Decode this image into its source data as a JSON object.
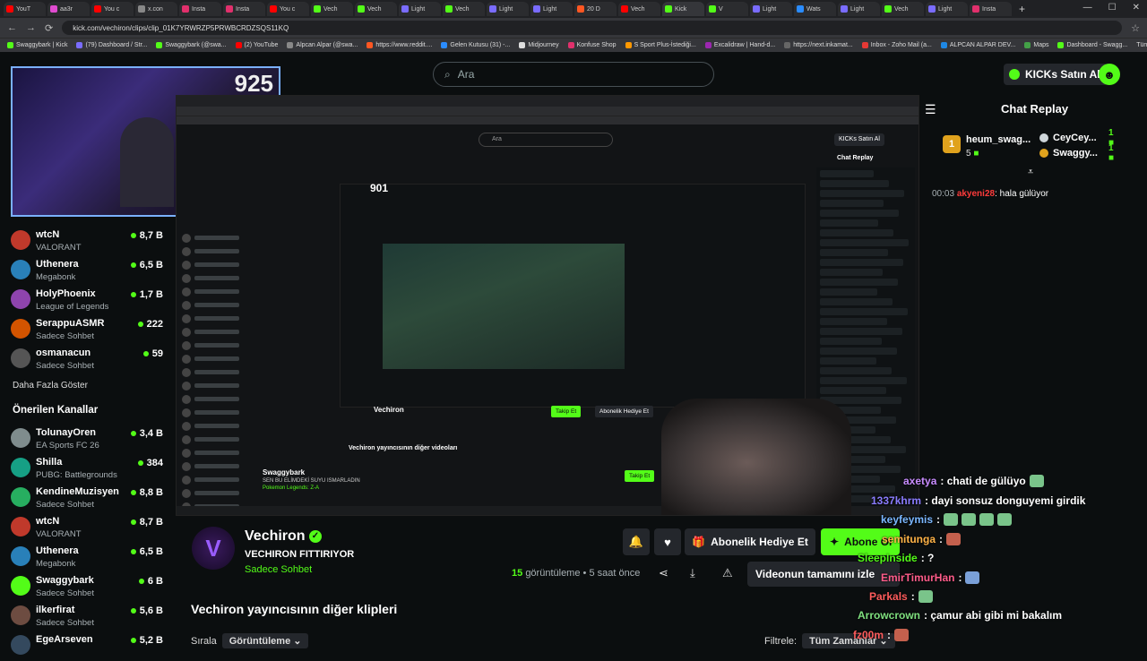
{
  "browser": {
    "tabs": [
      "YouT",
      "aa3r",
      "You c",
      "x.con",
      "Insta",
      "Insta",
      "You c",
      "Vech",
      "Vech",
      "Light",
      "Vech",
      "Light",
      "Light",
      "20 D",
      "Vech",
      "Kick",
      "V",
      "Light",
      "Wats",
      "Light",
      "Vech",
      "Light",
      "Insta"
    ],
    "url": "kick.com/vechiron/clips/clip_01K7YRWRZP5PRWBCRDZSQS11KQ",
    "bookmarks": [
      "Swaggybark | Kick",
      "(79) Dashboard / Str...",
      "Swaggybark (@swa...",
      "(2) YouTube",
      "Alpcan Alpar (@swa...",
      "https://www.reddit....",
      "Gelen Kutusu (31) -...",
      "Midjourney",
      "Konfuse Shop",
      "S Sport Plus-İstediği...",
      "Excalidraw | Hand-d...",
      "https://next.inkamat...",
      "Inbox - Zoho Mail (a...",
      "ALPCAN ALPAR DEV...",
      "Maps",
      "Dashboard - Swagg..."
    ],
    "bookmarks_right": "Tüm Yer İşaretleri"
  },
  "header": {
    "search_placeholder": "Ara",
    "kicks_label": "KICKs Satın Al"
  },
  "webcam": {
    "viewer_count": "925"
  },
  "sidebar": {
    "followed": [
      {
        "name": "wtcN",
        "category": "VALORANT",
        "viewers": "8,7 B",
        "color": "#c0392b"
      },
      {
        "name": "Uthenera",
        "category": "Megabonk",
        "viewers": "6,5 B",
        "color": "#2980b9"
      },
      {
        "name": "HolyPhoenix",
        "category": "League of Legends",
        "viewers": "1,7 B",
        "color": "#8e44ad"
      },
      {
        "name": "SerappuASMR",
        "category": "Sadece Sohbet",
        "viewers": "222",
        "color": "#d35400"
      },
      {
        "name": "osmanacun",
        "category": "Sadece Sohbet",
        "viewers": "59",
        "color": "#555555"
      }
    ],
    "show_more": "Daha Fazla Göster",
    "recommended_title": "Önerilen Kanallar",
    "recommended": [
      {
        "name": "TolunayOren",
        "category": "EA Sports FC 26",
        "viewers": "3,4 B",
        "color": "#7f8c8d"
      },
      {
        "name": "Shilla",
        "category": "PUBG: Battlegrounds",
        "viewers": "384",
        "color": "#16a085"
      },
      {
        "name": "KendineMuzisyen",
        "category": "Sadece Sohbet",
        "viewers": "8,8 B",
        "color": "#27ae60"
      },
      {
        "name": "wtcN",
        "category": "VALORANT",
        "viewers": "8,7 B",
        "color": "#c0392b"
      },
      {
        "name": "Uthenera",
        "category": "Megabonk",
        "viewers": "6,5 B",
        "color": "#2980b9"
      },
      {
        "name": "Swaggybark",
        "category": "Sadece Sohbet",
        "viewers": "6 B",
        "color": "#53fc18"
      },
      {
        "name": "ilkerfirat",
        "category": "Sadece Sohbet",
        "viewers": "5,6 B",
        "color": "#6d4c41"
      },
      {
        "name": "EgeArseven",
        "category": "",
        "viewers": "5,2 B",
        "color": "#34495e"
      }
    ]
  },
  "inner_screen": {
    "search": "Ara",
    "kicks": "KICKs Satın Al",
    "chat_title": "Chat Replay",
    "viewer_count": "901",
    "channel_name": "Vechiron",
    "videos_title": "Vechiron yayıncısının diğer videoları",
    "follow": "Takip Et",
    "gift": "Abonelik Hediye Et",
    "swaggy_name": "Swaggybark",
    "swaggy_title": "SEN BU ELİMDEKİ SUYU ISMARLADIN",
    "swaggy_cat": "Pokemon Legends: Z-A"
  },
  "channel": {
    "name": "Vechiron",
    "title": "VECHIRON FITTIRIYOR",
    "category": "Sadece Sohbet",
    "gift_label": "Abonelik Hediye Et",
    "subscribe_label": "Abone Ol",
    "views": "15",
    "views_label": "görüntüleme",
    "time": "5 saat önce",
    "full_video_label": "Videonun tamamını izle"
  },
  "clips": {
    "heading": "Vechiron yayıncısının diğer klipleri",
    "sort_label": "Sırala",
    "sort_value": "Görüntüleme",
    "filter_label": "Filtrele:",
    "filter_value": "Tüm Zamanlar"
  },
  "chat": {
    "title": "Chat Replay",
    "leader": {
      "rank": "1",
      "name": "heum_swag...",
      "count": "5"
    },
    "others": [
      {
        "name": "CeyCey...",
        "count": "1"
      },
      {
        "name": "Swaggy...",
        "count": "1"
      }
    ],
    "message": {
      "time": "00:03",
      "user": "akyeni28",
      "text": ": hala gülüyor"
    }
  },
  "overlay_chat": [
    {
      "user": "axetya",
      "text": ": chati de gülüyo",
      "color": "#c88cff"
    },
    {
      "user": "1337khrm",
      "text": ": dayi sonsuz donguyemi girdik",
      "color": "#8a7cff"
    },
    {
      "user": "keyfeymis",
      "text": ":",
      "color": "#7ab7ff"
    },
    {
      "user": "semitunga",
      "text": ":",
      "color": "#ffb347"
    },
    {
      "user": "SleepInside",
      "text": ": ?",
      "color": "#53fc18"
    },
    {
      "user": "EmirTimurHan",
      "text": ":",
      "color": "#ff5c8a"
    },
    {
      "user": "Parkals",
      "text": ":",
      "color": "#ff5c5c"
    },
    {
      "user": "Arrowcrown",
      "text": ": çamur abi gibi mi bakalım",
      "color": "#7fe07f"
    },
    {
      "user": "fz00m",
      "text": ":",
      "color": "#ff5c5c"
    }
  ]
}
